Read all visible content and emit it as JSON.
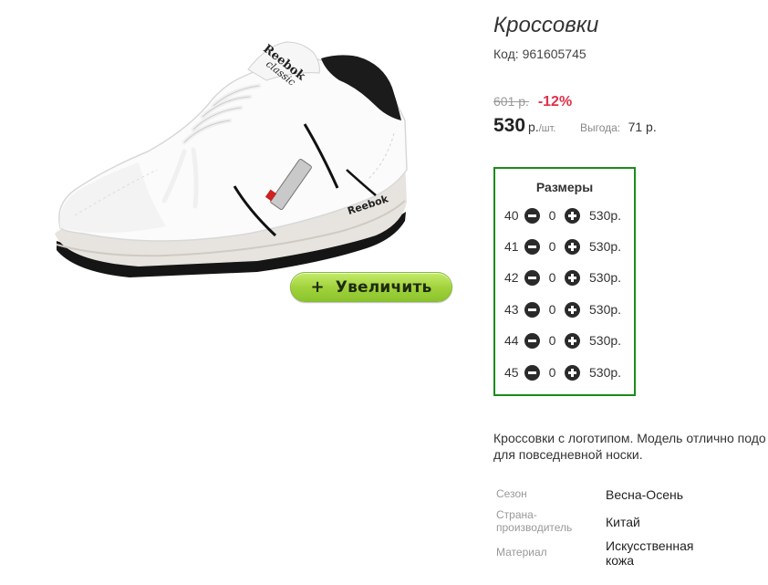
{
  "product": {
    "title": "Кроссовки",
    "code_label": "Код:",
    "code": "961605745",
    "old_price": "601 р.",
    "discount": "-12%",
    "price": "530",
    "price_unit": "р.",
    "price_unit_sub": "/шт.",
    "benefit_label": "Выгода:",
    "benefit_value": "71 р."
  },
  "gallery": {
    "image_icon": "sneaker-photo",
    "zoom_label": "Увеличить",
    "zoom_icon": "plus-icon",
    "shoe_brand_text": "Reebok classic"
  },
  "sizes": {
    "title": "Размеры",
    "rows": [
      {
        "size": "40",
        "qty": "0",
        "price": "530р."
      },
      {
        "size": "41",
        "qty": "0",
        "price": "530р."
      },
      {
        "size": "42",
        "qty": "0",
        "price": "530р."
      },
      {
        "size": "43",
        "qty": "0",
        "price": "530р."
      },
      {
        "size": "44",
        "qty": "0",
        "price": "530р."
      },
      {
        "size": "45",
        "qty": "0",
        "price": "530р."
      }
    ],
    "border_color": "#1a8c1a"
  },
  "description": {
    "line1": "Кроссовки с логотипом. Модель отлично подо",
    "line2": "для повседневной носки."
  },
  "attributes": [
    {
      "label": "Сезон",
      "value": "Весна-Осень"
    },
    {
      "label_line1": "Страна-",
      "label_line2": "производитель",
      "value": "Китай"
    },
    {
      "label": "Материал",
      "value_line1": "Искусственная",
      "value_line2": "кожа"
    }
  ],
  "colors": {
    "discount": "#e0304a",
    "zoom_button": "#9fd13a"
  }
}
